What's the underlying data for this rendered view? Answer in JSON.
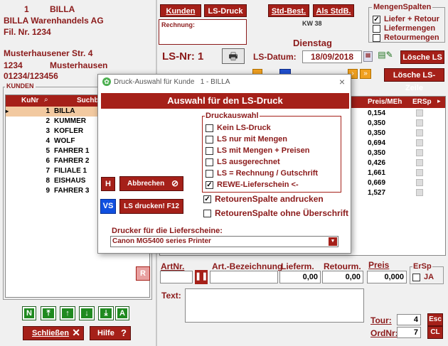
{
  "customer": {
    "number": "1",
    "short": "BILLA",
    "company": "BILLA Warenhandels AG",
    "branch": "Fil. Nr. 1234",
    "street": "Musterhausener Str. 4",
    "zip": "1234",
    "city": "Musterhausen",
    "phone": "01234/123456"
  },
  "toolbar": {
    "kunden": "Kunden",
    "lsdruck": "LS-Druck",
    "stdbest": "Std-Best.",
    "alsstdb": "Als StdB."
  },
  "rechnung_label": "Rechnung:",
  "kw": "KW 38",
  "weekday": "Dienstag",
  "ls_nr_label": "LS-Nr: 1",
  "ls_datum_label": "LS-Datum:",
  "ls_datum_value": "18/09/2018",
  "loesche_ls": "Lösche LS",
  "loesche_ls_zeile": "Lösche LS-Zeile",
  "mengen": {
    "title": "MengenSpalten",
    "items": [
      {
        "label": "Liefer + Retour",
        "checked": true
      },
      {
        "label": "Liefermengen",
        "checked": false
      },
      {
        "label": "Retourmengen",
        "checked": false
      }
    ]
  },
  "kunden": {
    "title": "KUNDEN",
    "col_kunr": "KuNr",
    "col_suchb": "Suchb",
    "rows": [
      {
        "nr": "1",
        "name": "BILLA"
      },
      {
        "nr": "2",
        "name": "KUMMER"
      },
      {
        "nr": "3",
        "name": "KOFLER"
      },
      {
        "nr": "4",
        "name": "WOLF"
      },
      {
        "nr": "5",
        "name": "FAHRER 1"
      },
      {
        "nr": "6",
        "name": "FAHRER 2"
      },
      {
        "nr": "7",
        "name": "FILIALE 1"
      },
      {
        "nr": "8",
        "name": "EISHAUS"
      },
      {
        "nr": "9",
        "name": "FAHRER 3"
      }
    ]
  },
  "lines": {
    "col_preis": "Preis/MEh",
    "col_ersp": "ERSp",
    "prices": [
      "0,154",
      "0,350",
      "0,350",
      "0,694",
      "0,350",
      "0,426",
      "1,661",
      "0,669",
      "1,527"
    ]
  },
  "bottom_left": {
    "n": "N",
    "a": "A",
    "schliessen": "Schließen",
    "hilfe": "Hilfe"
  },
  "entry": {
    "artnr": "ArtNr.",
    "artbez": "Art.-Bezeichnung",
    "lieferm": "Lieferm.",
    "retourm": "Retourm.",
    "preis": "Preis",
    "ersp": "ErSp",
    "ja": "JA",
    "lieferm_val": "0,00",
    "retourm_val": "0,00",
    "preis_val": "0,000",
    "r": "R",
    "text": "Text:",
    "tour": "Tour:",
    "tour_val": "4",
    "ordnr": "OrdNr:",
    "ordnr_val": "7",
    "esc": "Esc",
    "cl": "CL"
  },
  "dialog": {
    "title": "Druck-Auswahl für Kunde   1 - BILLA",
    "header": "Auswahl für den LS-Druck",
    "group_title": "Druckauswahl",
    "options": [
      {
        "label": "Kein LS-Druck",
        "checked": false
      },
      {
        "label": "LS nur mit Mengen",
        "checked": false
      },
      {
        "label": "LS mit Mengen + Preisen",
        "checked": false
      },
      {
        "label": "LS ausgerechnet",
        "checked": false
      },
      {
        "label": "LS = Rechnung / Gutschrift",
        "checked": false
      },
      {
        "label": "REWE-Lieferschein <-",
        "checked": true
      }
    ],
    "retouren1": "RetourenSpalte andrucken",
    "retouren2": "RetourenSpalte ohne Überschrift",
    "h": "H",
    "abbrechen": "Abbrechen",
    "vs": "VS",
    "drucken": "LS drucken! F12",
    "drucker_label": "Drucker für die Lieferscheine:",
    "drucker_value": "Canon MG5400 series Printer"
  }
}
